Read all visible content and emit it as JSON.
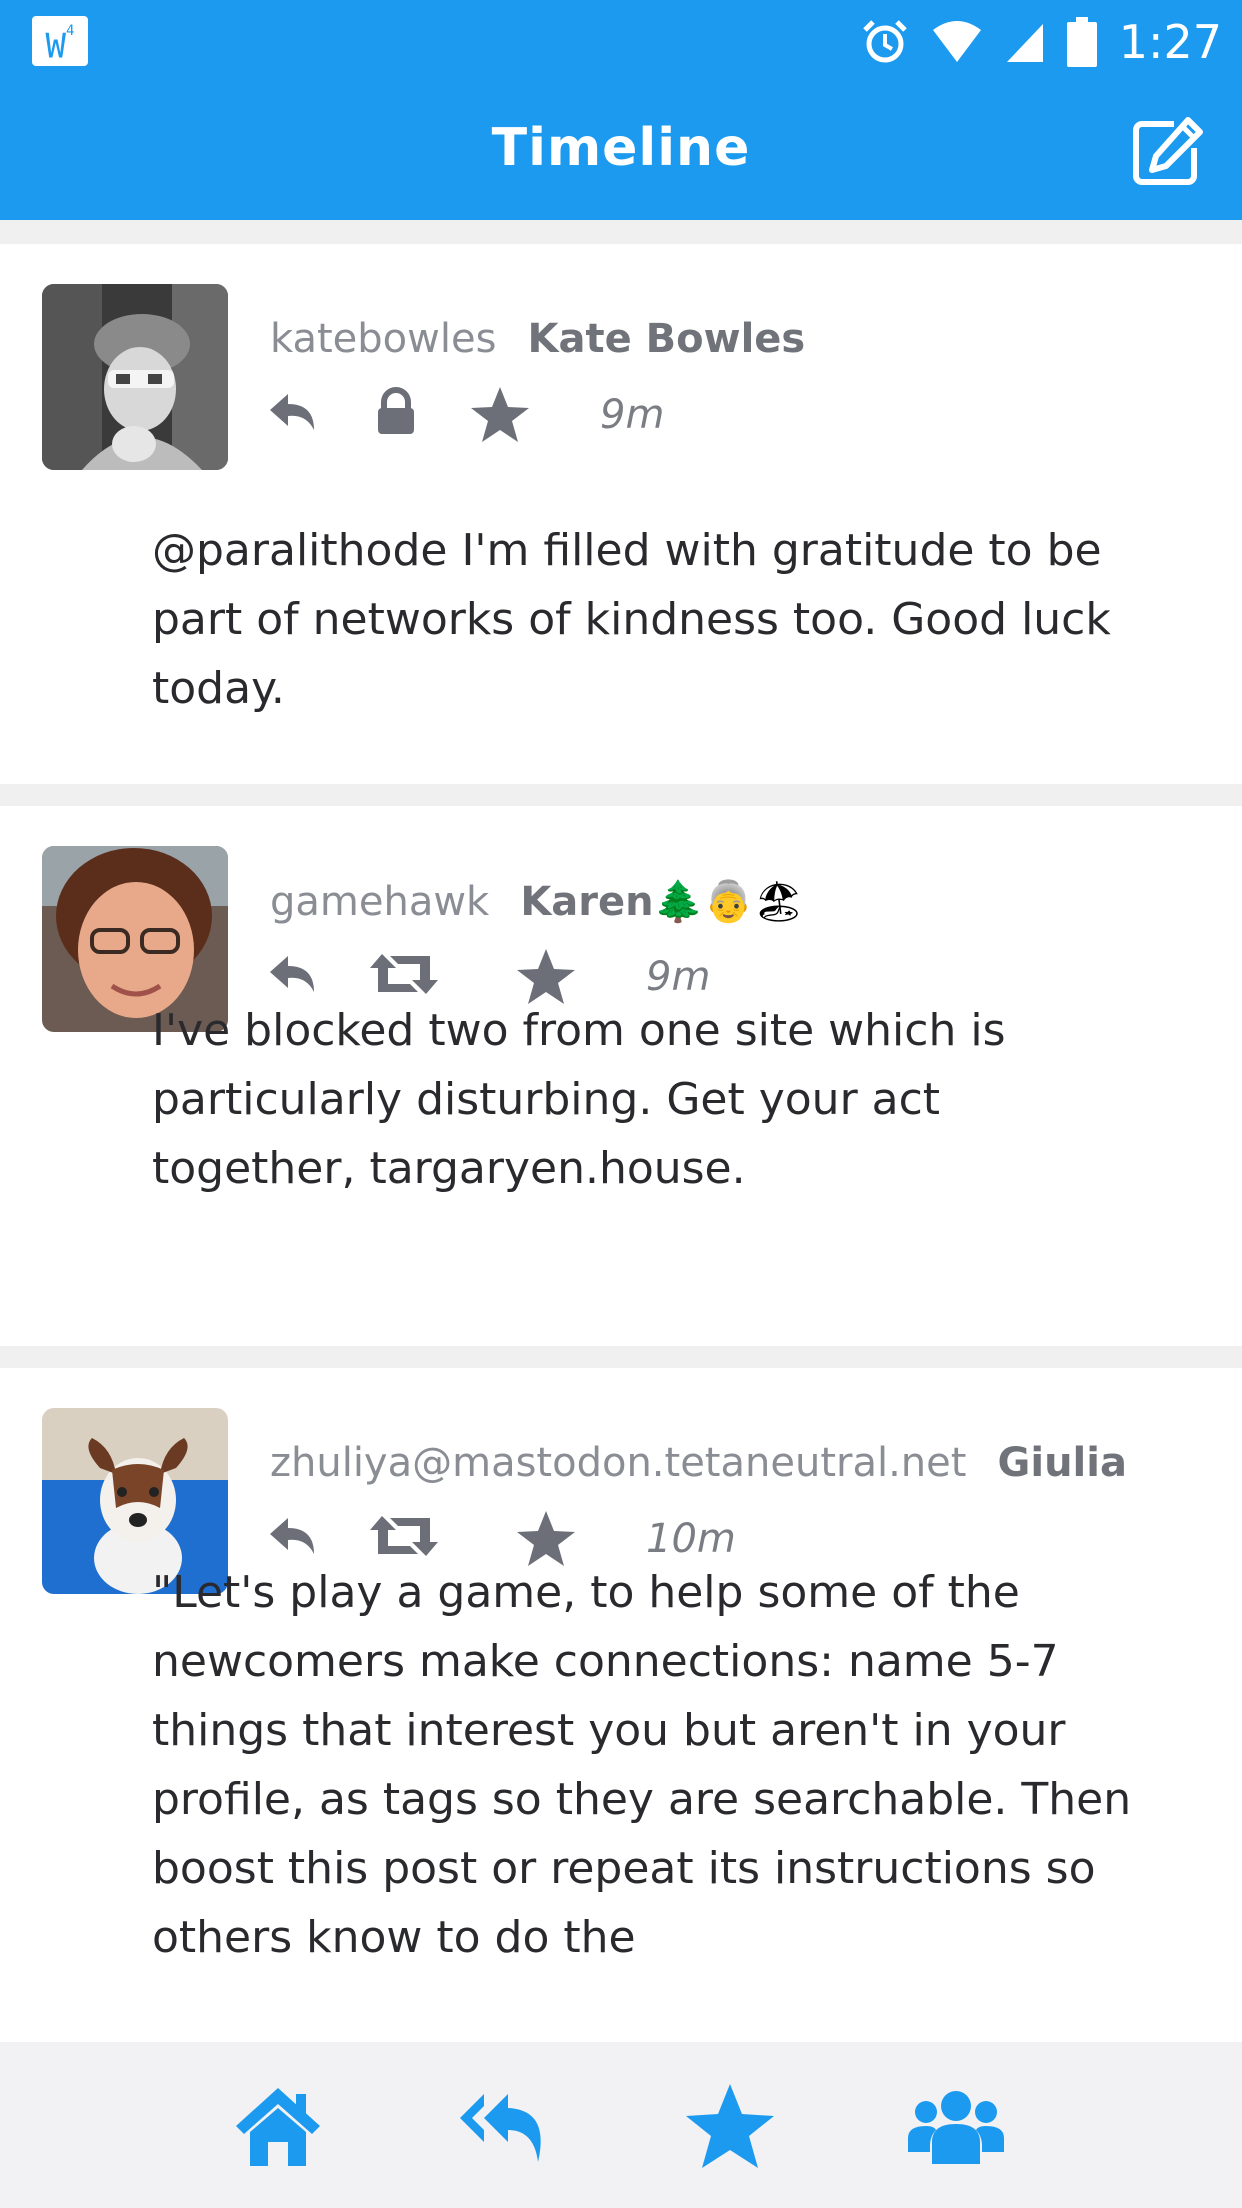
{
  "statusbar": {
    "time": "1:27",
    "logo_text": "W",
    "logo_sup": "4"
  },
  "appbar": {
    "title": "Timeline"
  },
  "posts": [
    {
      "username": "katebowles",
      "display_name": "Kate Bowles",
      "time": "9m",
      "visibility": "private",
      "content": "@paralithode I'm filled with gratitude to be part of networks of kindness too. Good luck today."
    },
    {
      "username": "gamehawk",
      "display_name": "Karen",
      "display_emoji": "🌲👵🏖",
      "time": "9m",
      "visibility": "public",
      "content": "I've blocked two from one site which is particularly disturbing. Get your act together, targaryen.house."
    },
    {
      "username": "zhuliya@mastodon.tetaneutral.net",
      "display_name": "Giulia",
      "time": "10m",
      "visibility": "public",
      "content": "\"Let's play a game, to help some of the newcomers make connections: name 5-7 things that interest you but aren't in your profile, as tags so they are searchable. Then boost this post or repeat its instructions so others know to do the"
    }
  ],
  "colors": {
    "brand": "#1c9af0",
    "icon_gray": "#6c6f78",
    "text": "#2a2a2e"
  },
  "bottom_nav": [
    "home-icon",
    "mentions-icon",
    "favourites-icon",
    "community-icon"
  ]
}
